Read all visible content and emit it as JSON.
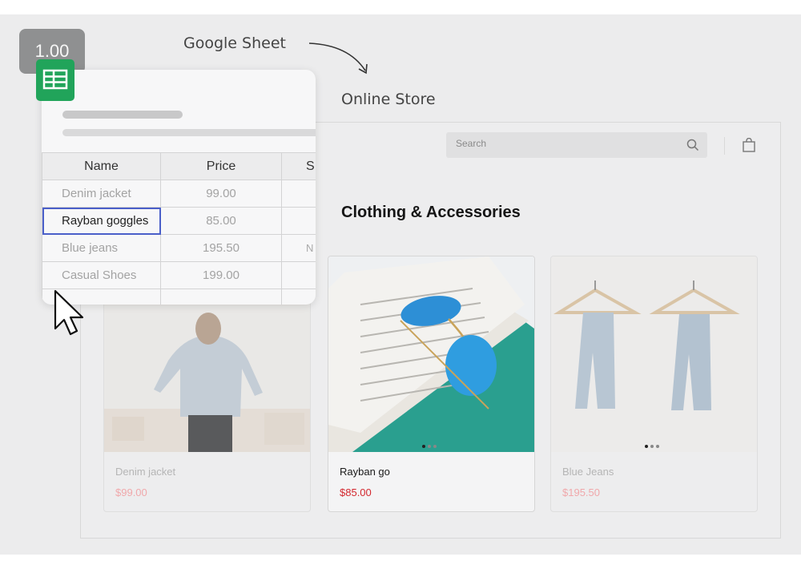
{
  "zoom": "1.00",
  "captions": {
    "sheet": "Google Sheet",
    "store": "Online Store"
  },
  "sheet": {
    "columns": [
      "Name",
      "Price",
      "S"
    ],
    "rows": [
      {
        "name": "Denim jacket",
        "price": "99.00",
        "extra": ""
      },
      {
        "name": "Rayban goggles",
        "price": "85.00",
        "extra": ""
      },
      {
        "name": "Blue jeans",
        "price": "195.50",
        "extra": "N"
      },
      {
        "name": "Casual Shoes",
        "price": "199.00",
        "extra": ""
      },
      {
        "name": "",
        "price": "",
        "extra": ""
      }
    ]
  },
  "store": {
    "search_placeholder": "Search",
    "title": "Clothing & Accessories",
    "products": [
      {
        "name": "Denim jacket",
        "price": "$99.00"
      },
      {
        "name": "Rayban go",
        "price": "$85.00"
      },
      {
        "name": "Blue Jeans",
        "price": "$195.50"
      }
    ]
  },
  "colors": {
    "sheets_green": "#21a45a",
    "price_red": "#d3282f",
    "selection_blue": "#4a5fc9"
  },
  "icons": [
    "google-sheets-icon",
    "search-icon",
    "shopping-bag-icon",
    "mouse-cursor-icon",
    "curved-arrow-icon"
  ]
}
